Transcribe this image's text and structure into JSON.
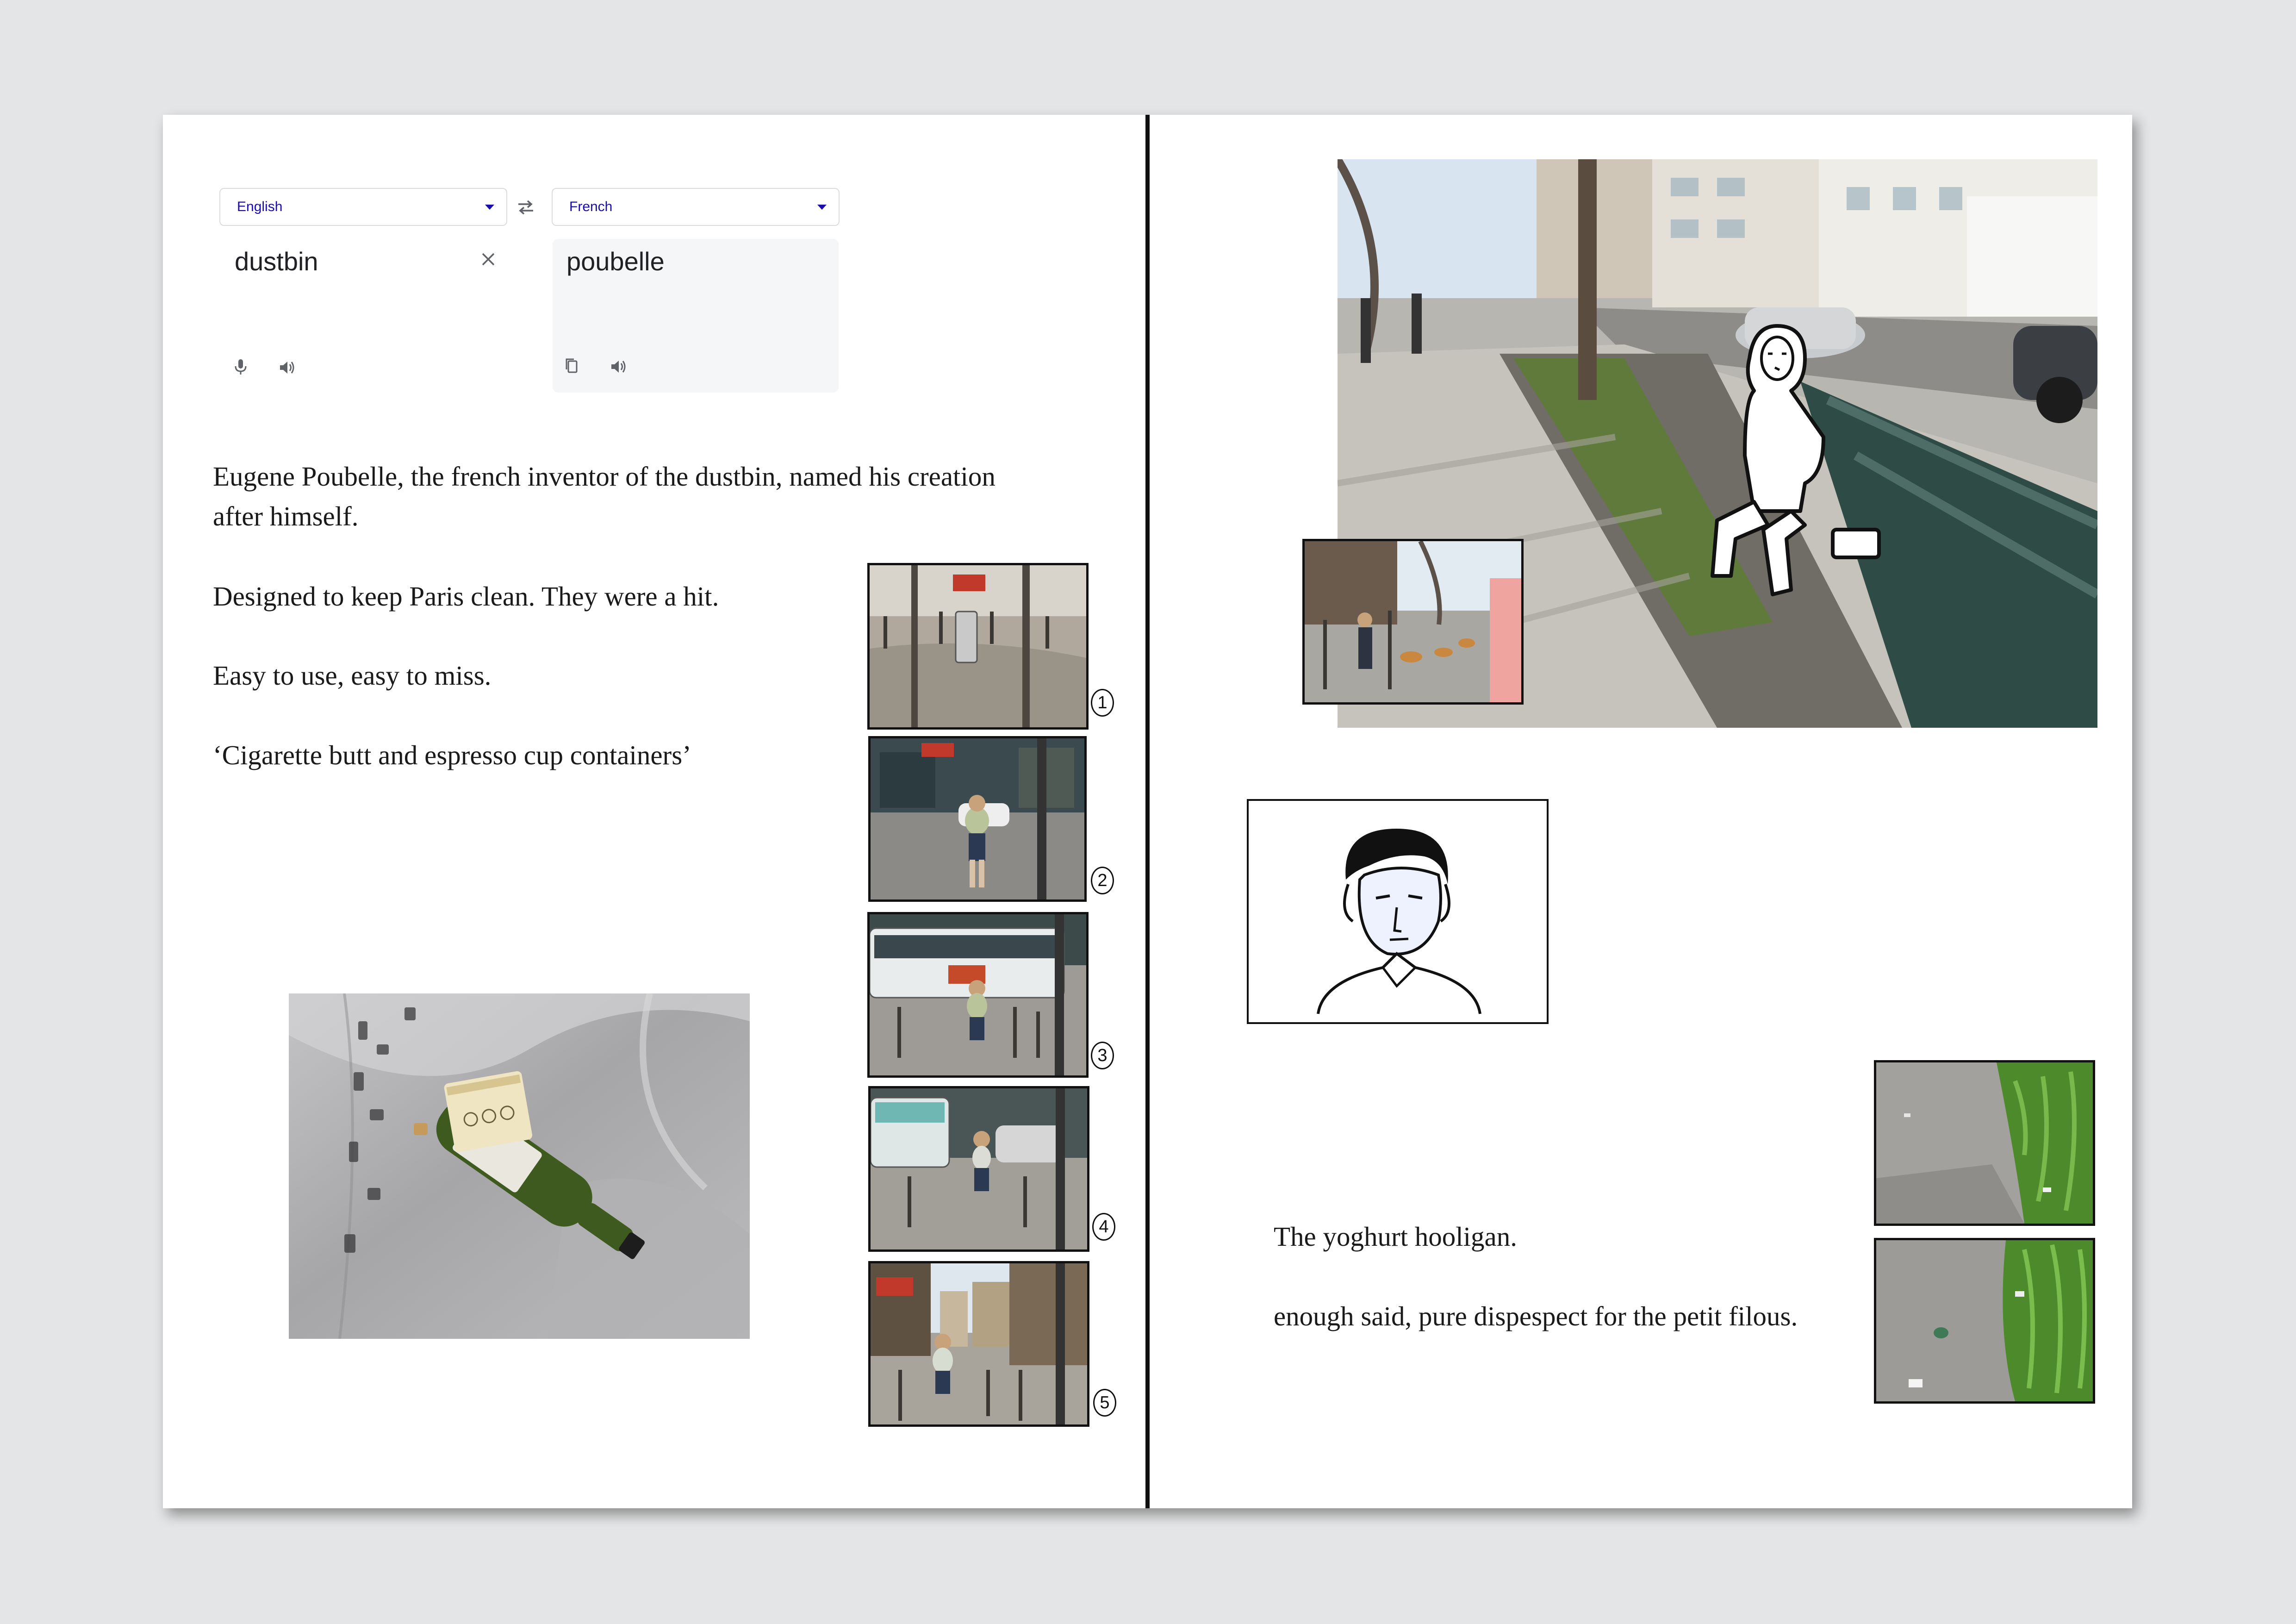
{
  "translate": {
    "source_lang": "English",
    "target_lang": "French",
    "source_text": "dustbin",
    "target_text": "poubelle"
  },
  "left_page": {
    "paragraph_1": "Eugene Poubelle, the french inventor of the dustbin, named his creation after himself.",
    "paragraph_2": "Designed to keep Paris clean. They were a hit.",
    "paragraph_3": "Easy to use, easy to miss.",
    "paragraph_4": "‘Cigarette butt and espresso cup containers’",
    "sequence_numbers": [
      "1",
      "2",
      "3",
      "4",
      "5"
    ]
  },
  "right_page": {
    "caption_1": "The yoghurt hooligan.",
    "caption_2": "enough said, pure dispespect for the petit filous."
  },
  "colors": {
    "translate_link": "#1a0dab",
    "page_background": "#ffffff",
    "backdrop": "#e4e5e6"
  },
  "icons": [
    "swap-arrows-icon",
    "close-icon",
    "microphone-icon",
    "speaker-icon",
    "copy-icon",
    "caret-down-icon"
  ]
}
